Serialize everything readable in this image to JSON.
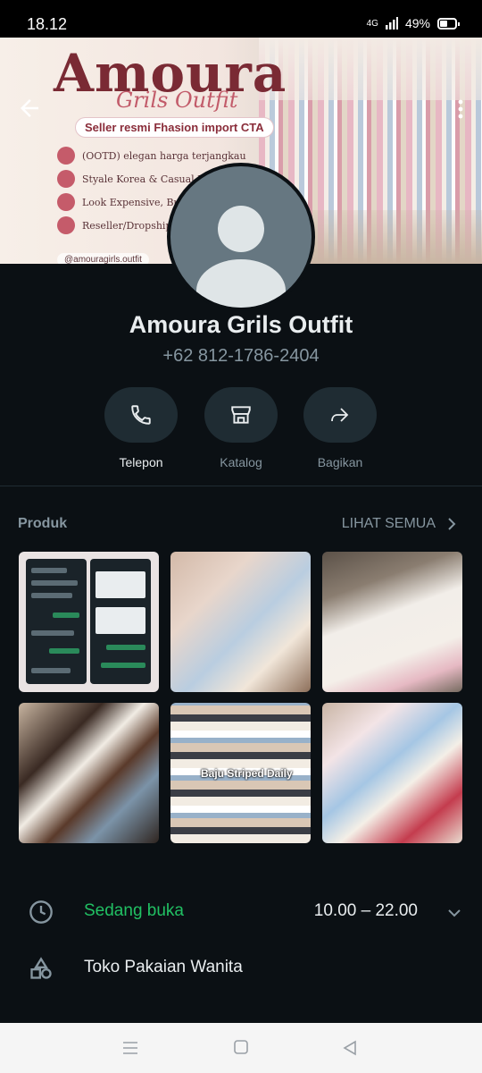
{
  "status_bar": {
    "time": "18.12",
    "network": "4G",
    "battery": "49%"
  },
  "banner": {
    "brand": "Amoura",
    "subtitle": "Grils Outfit",
    "seller_tag": "Seller resmi Fhasion import CTA",
    "features": [
      "(OOTD) elegan harga terjangkau",
      "Styale Korea & Casual Impor",
      "Look Expensive, Budg",
      "Reseller/Dropship W"
    ],
    "handle": "@amouragirls.outfit"
  },
  "profile": {
    "name": "Amoura Grils Outfit",
    "phone": "+62 812-1786-2404"
  },
  "actions": [
    {
      "label": "Telepon",
      "icon": "phone-icon"
    },
    {
      "label": "Katalog",
      "icon": "store-icon"
    },
    {
      "label": "Bagikan",
      "icon": "share-icon"
    }
  ],
  "products": {
    "title": "Produk",
    "see_all": "LIHAT SEMUA",
    "tile_caption": "Baju Striped Daily"
  },
  "business": {
    "status": "Sedang buka",
    "hours": "10.00 – 22.00",
    "category": "Toko Pakaian Wanita"
  },
  "colors": {
    "background": "#0b1014",
    "open_green": "#21c063",
    "secondary_text": "#8696a0",
    "button_bg": "#1f2c33"
  }
}
